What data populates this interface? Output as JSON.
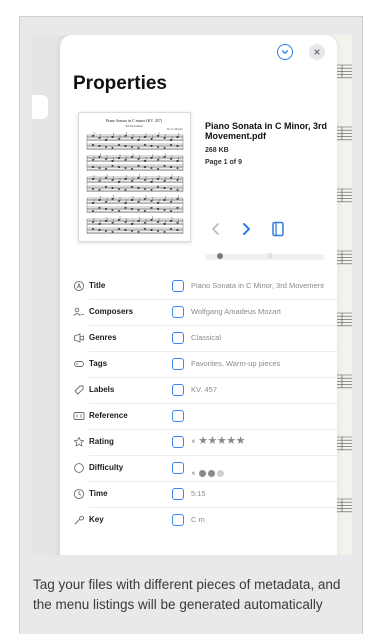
{
  "sheet": {
    "title": "Properties",
    "file": {
      "name": "Piano Sonata in C Minor, 3rd Movement.pdf",
      "size": "268 KB",
      "page": "Page 1 of 9",
      "thumb_title": "Piano Sonata in C minor (KV. 457)",
      "thumb_subtitle": "3rd Movement",
      "thumb_composer": "W. A. Mozart"
    },
    "pager": {
      "total_dots": 2,
      "current": 0
    }
  },
  "properties": [
    {
      "key": "title",
      "label": "Title",
      "icon": "title-icon",
      "value": "Piano Sonata in C Minor, 3rd Movement"
    },
    {
      "key": "composers",
      "label": "Composers",
      "icon": "composer-icon",
      "value": "Wolfgang Amadeus Mozart"
    },
    {
      "key": "genres",
      "label": "Genres",
      "icon": "genre-icon",
      "value": "Classical"
    },
    {
      "key": "tags",
      "label": "Tags",
      "icon": "tag-icon",
      "value": "Favorites, Warm-up pieces"
    },
    {
      "key": "labels",
      "label": "Labels",
      "icon": "label-icon",
      "value": "KV. 457"
    },
    {
      "key": "reference",
      "label": "Reference",
      "icon": "reference-icon",
      "value": ""
    },
    {
      "key": "rating",
      "label": "Rating",
      "icon": "star-icon",
      "value": "",
      "clear_glyph": "×",
      "stars": 5,
      "stars_filled": 0
    },
    {
      "key": "difficulty",
      "label": "Difficulty",
      "icon": "circle-icon",
      "value": "",
      "clear_glyph": "×",
      "levels": 3
    },
    {
      "key": "time",
      "label": "Time",
      "icon": "clock-icon",
      "value": "5:15"
    },
    {
      "key": "key",
      "label": "Key",
      "icon": "key-icon",
      "value": "C m"
    }
  ],
  "colors": {
    "accent": "#2f7be5",
    "checkbox": "#3d86ea",
    "muted": "#8a8a8e",
    "dot_dark": "#8a8a8e",
    "dot_light": "#cfcfd3"
  },
  "caption": "Tag your files with different pieces of metadata, and the menu listings will be generated automatically"
}
